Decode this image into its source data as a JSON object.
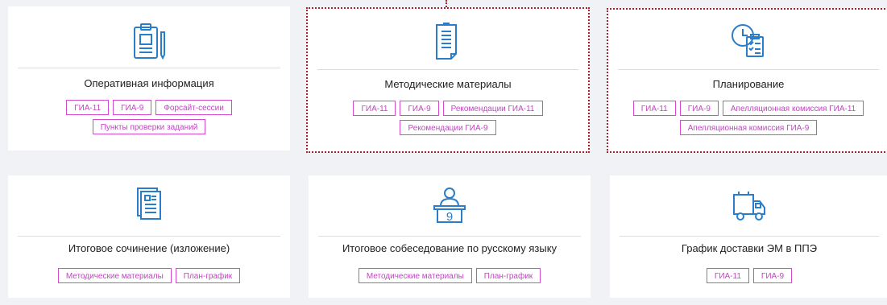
{
  "cards": [
    {
      "title": "Оперативная информация",
      "icon": "clipboard-pencil-icon",
      "tags": [
        "ГИА-11",
        "ГИА-9",
        "Форсайт-сессии",
        "Пункты проверки заданий"
      ]
    },
    {
      "title": "Методические материалы",
      "icon": "document-lines-icon",
      "tags": [
        "ГИА-11",
        "ГИА-9",
        "Рекомендации ГИА-11",
        "Рекомендации ГИА-9"
      ]
    },
    {
      "title": "Планирование",
      "icon": "clock-checklist-icon",
      "tags": [
        "ГИА-11",
        "ГИА-9",
        "Апелляционная комиссия ГИА-11",
        "Апелляционная комиссия ГИА-9"
      ]
    },
    {
      "title": "Итоговое сочинение (изложение)",
      "icon": "document-stack-icon",
      "tags": [
        "Методические материалы",
        "План-график"
      ]
    },
    {
      "title": "Итоговое собеседование по русскому языку",
      "icon": "person-desk-icon",
      "icon_text": "9",
      "tags": [
        "Методические материалы",
        "План-график"
      ]
    },
    {
      "title": "График доставки ЭМ в ППЭ",
      "icon": "delivery-truck-icon",
      "tags": [
        "ГИА-11",
        "ГИА-9"
      ]
    }
  ],
  "colors": {
    "accent_icon": "#2a7ec9",
    "tag_border": "#d54ad0",
    "highlight_dotted": "#b11e2a",
    "background": "#f1f2f5"
  }
}
